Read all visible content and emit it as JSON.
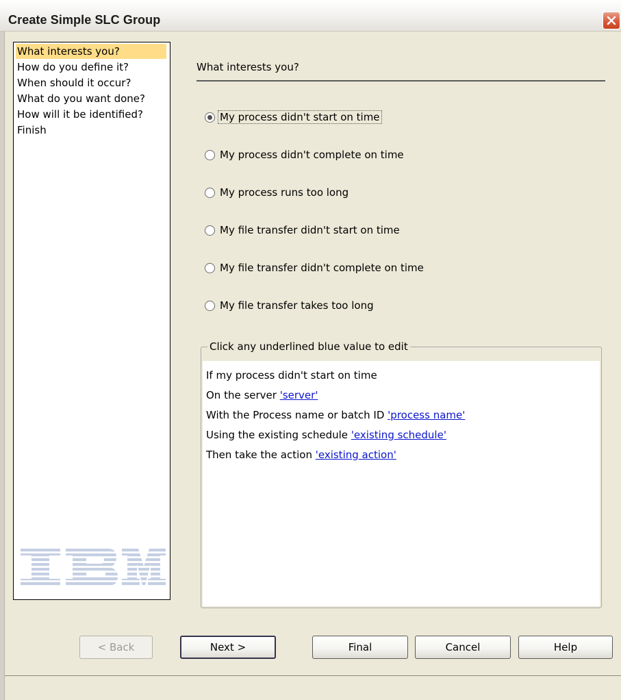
{
  "window": {
    "title": "Create Simple SLC Group"
  },
  "nav": {
    "items": [
      {
        "label": "What interests you?",
        "selected": true
      },
      {
        "label": "How do you define it?",
        "selected": false
      },
      {
        "label": "When should it occur?",
        "selected": false
      },
      {
        "label": "What do you want done?",
        "selected": false
      },
      {
        "label": "How will it be identified?",
        "selected": false
      },
      {
        "label": "Finish",
        "selected": false
      }
    ],
    "logo_text": "IBM"
  },
  "main": {
    "section_title": "What interests you?",
    "options": [
      {
        "label": "My process didn't start on time",
        "selected": true
      },
      {
        "label": "My process didn't complete on time",
        "selected": false
      },
      {
        "label": "My process runs too long",
        "selected": false
      },
      {
        "label": "My file transfer didn't start on time",
        "selected": false
      },
      {
        "label": "My file transfer didn't complete on time",
        "selected": false
      },
      {
        "label": "My file transfer takes too long",
        "selected": false
      }
    ],
    "summary": {
      "legend": "Click any underlined blue value to edit",
      "line1": "If my process didn't start on time",
      "line2_prefix": "On the server ",
      "line2_link": "'server'",
      "line3_prefix": "With the Process name or batch ID ",
      "line3_link": "'process name'",
      "line4_prefix": "Using the existing schedule ",
      "line4_link": "'existing schedule'",
      "line5_prefix": "Then take the action ",
      "line5_link": "'existing action'"
    }
  },
  "buttons": {
    "back": "< Back",
    "next": "Next >",
    "final": "Final",
    "cancel": "Cancel",
    "help": "Help"
  },
  "colors": {
    "selection_highlight": "#ffdd88",
    "link": "#0b14cc",
    "close_button": "#d65a3d"
  }
}
